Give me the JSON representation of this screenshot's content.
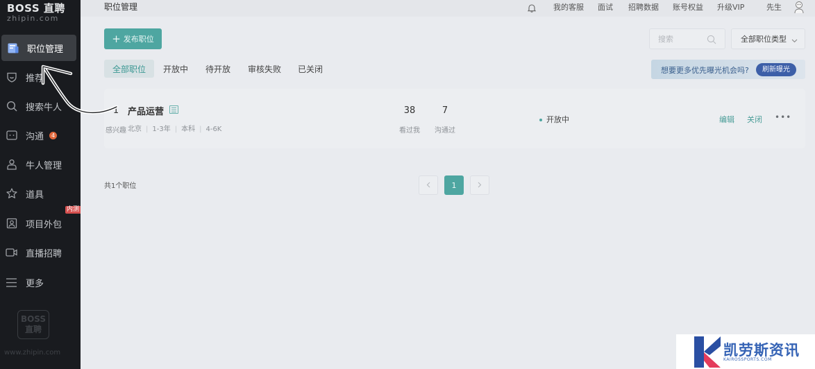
{
  "sidebar": {
    "logo_main": "BOSS 直聘",
    "logo_sub": "zhipin.com",
    "items": [
      {
        "label": "职位管理"
      },
      {
        "label": "推荐"
      },
      {
        "label": "搜索牛人"
      },
      {
        "label": "沟通",
        "badge": "4"
      },
      {
        "label": "牛人管理"
      },
      {
        "label": "道具"
      },
      {
        "label": "项目外包",
        "tag": "内测"
      },
      {
        "label": "直播招聘"
      },
      {
        "label": "更多"
      }
    ],
    "watermark_line1": "BOSS",
    "watermark_line2": "直聘",
    "footer_url": "www.zhipin.com"
  },
  "topbar": {
    "title": "职位管理",
    "links": [
      "我的客服",
      "面试",
      "招聘数据",
      "账号权益",
      "升级VIP"
    ],
    "user": "先生"
  },
  "toolbar": {
    "publish_label": "发布职位",
    "search_placeholder": "搜索",
    "type_filter": "全部职位类型"
  },
  "tabs": [
    "全部职位",
    "开放中",
    "待开放",
    "审核失败",
    "已关闭"
  ],
  "promo": {
    "text": "想要更多优先曝光机会吗?",
    "button": "刷新曝光"
  },
  "job": {
    "title": "产品运营",
    "city": "北京",
    "experience": "1-3年",
    "education": "本科",
    "salary": "4-6K",
    "stats": [
      {
        "value": "38",
        "label": "看过我"
      },
      {
        "value": "7",
        "label": "沟通过"
      },
      {
        "value": "1",
        "label": "感兴趣"
      }
    ],
    "status": "开放中",
    "actions": [
      "编辑",
      "关闭"
    ],
    "more": "•••"
  },
  "pagination": {
    "total": "共1个职位",
    "current": "1"
  },
  "brand_watermark": {
    "name": "凯劳斯资讯",
    "sub": "KAIROSSPORTS.COM"
  },
  "colors": {
    "accent": "#4ea6a1",
    "sidebar_bg": "#191b1f",
    "badge": "#e0683c",
    "promo_button": "#3d5fa8"
  }
}
